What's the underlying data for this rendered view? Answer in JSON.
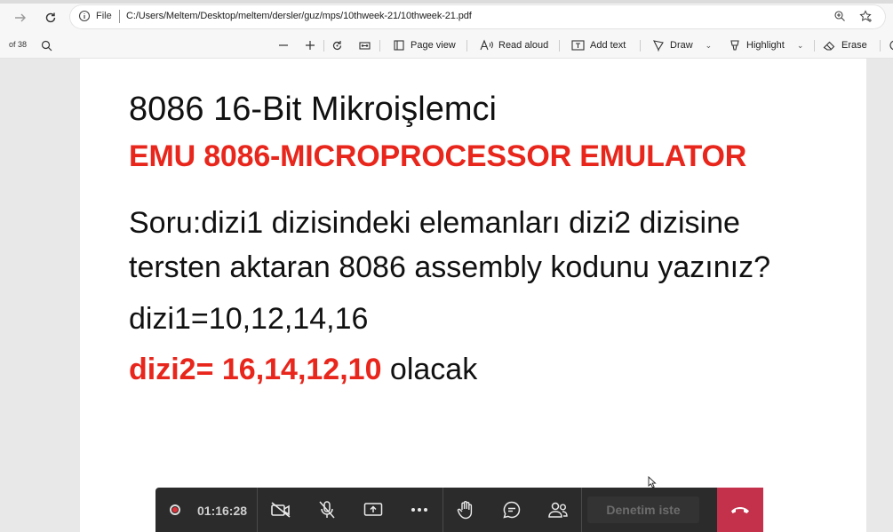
{
  "browser": {
    "file_label": "File",
    "url": "C:/Users/Meltem/Desktop/meltem/dersler/guz/mps/10thweek-21/10thweek-21.pdf"
  },
  "pdf_toolbar": {
    "page_count": "of 38",
    "page_view": "Page view",
    "read_aloud": "Read aloud",
    "add_text": "Add text",
    "draw": "Draw",
    "highlight": "Highlight",
    "erase": "Erase"
  },
  "slide": {
    "title": "8086 16-Bit Mikroişlemci",
    "subtitle": "EMU 8086-MICROPROCESSOR EMULATOR",
    "question_line1": "Soru:dizi1 dizisindeki elemanları dizi2 dizisine",
    "question_line2": "tersten aktaran 8086 assembly kodunu yazınız?",
    "dizi1": "dizi1=10,12,14,16",
    "dizi2_highlight": "dizi2= 16,14,12,10",
    "dizi2_rest": " olacak"
  },
  "meeting": {
    "elapsed": "01:16:28",
    "denetim_label": "Denetim iste"
  },
  "colors": {
    "accent_red": "#e8261c",
    "hangup_red": "#c4314b",
    "meeting_bar": "#2b2b2b"
  }
}
